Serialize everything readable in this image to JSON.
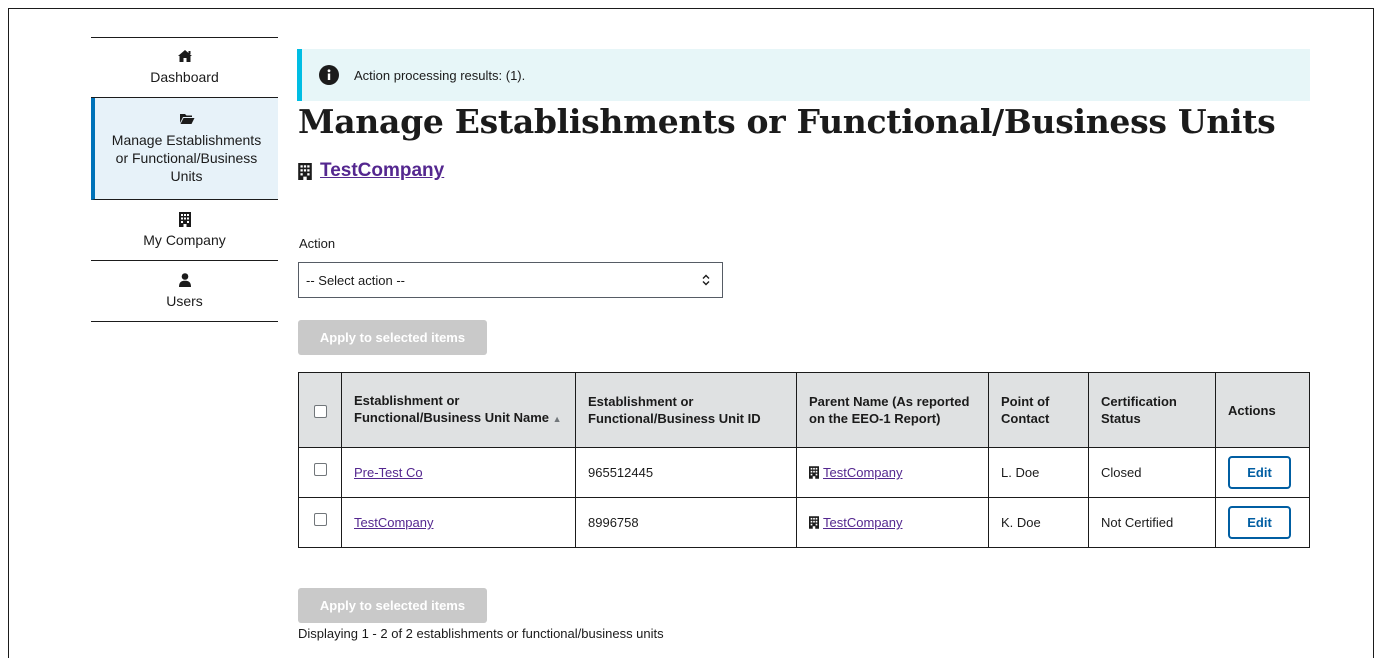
{
  "sidebar": {
    "items": [
      {
        "label": "Dashboard",
        "icon": "home-icon",
        "active": false
      },
      {
        "label": "Manage Establishments or Functional/Business Units",
        "icon": "folder-open-icon",
        "active": true
      },
      {
        "label": "My Company",
        "icon": "building-icon",
        "active": false
      },
      {
        "label": "Users",
        "icon": "user-icon",
        "active": false
      }
    ]
  },
  "alert": {
    "icon": "info-icon",
    "message": "Action processing results: (1)."
  },
  "page": {
    "title": "Manage Establishments or Functional/Business Units",
    "company_icon": "building-icon",
    "company_name": "TestCompany"
  },
  "action": {
    "label": "Action",
    "selected": "-- Select action --",
    "apply_label": "Apply to selected items"
  },
  "table": {
    "headers": [
      "Establishment or Functional/Business Unit Name",
      "Establishment or Functional/Business Unit ID",
      "Parent Name (As reported on the EEO-1 Report)",
      "Point of Contact",
      "Certification Status",
      "Actions"
    ],
    "sort_indicator": "▲",
    "rows": [
      {
        "name": "Pre-Test Co",
        "id": "965512445",
        "parent": "TestCompany",
        "contact": "L. Doe",
        "status": "Closed",
        "action": "Edit"
      },
      {
        "name": "TestCompany",
        "id": "8996758",
        "parent": "TestCompany",
        "contact": "K. Doe",
        "status": "Not Certified",
        "action": "Edit"
      }
    ]
  },
  "footer": {
    "apply_label": "Apply to selected items",
    "summary": "Displaying 1 - 2 of 2 establishments or functional/business units"
  },
  "colors": {
    "link": "#54278f",
    "primary": "#005ea2",
    "alert_bg": "#e7f6f8",
    "alert_border": "#00bde3",
    "active_sidebar_border": "#0072b8",
    "disabled_button": "#c9c9c9",
    "table_header_bg": "#dfe1e2"
  }
}
